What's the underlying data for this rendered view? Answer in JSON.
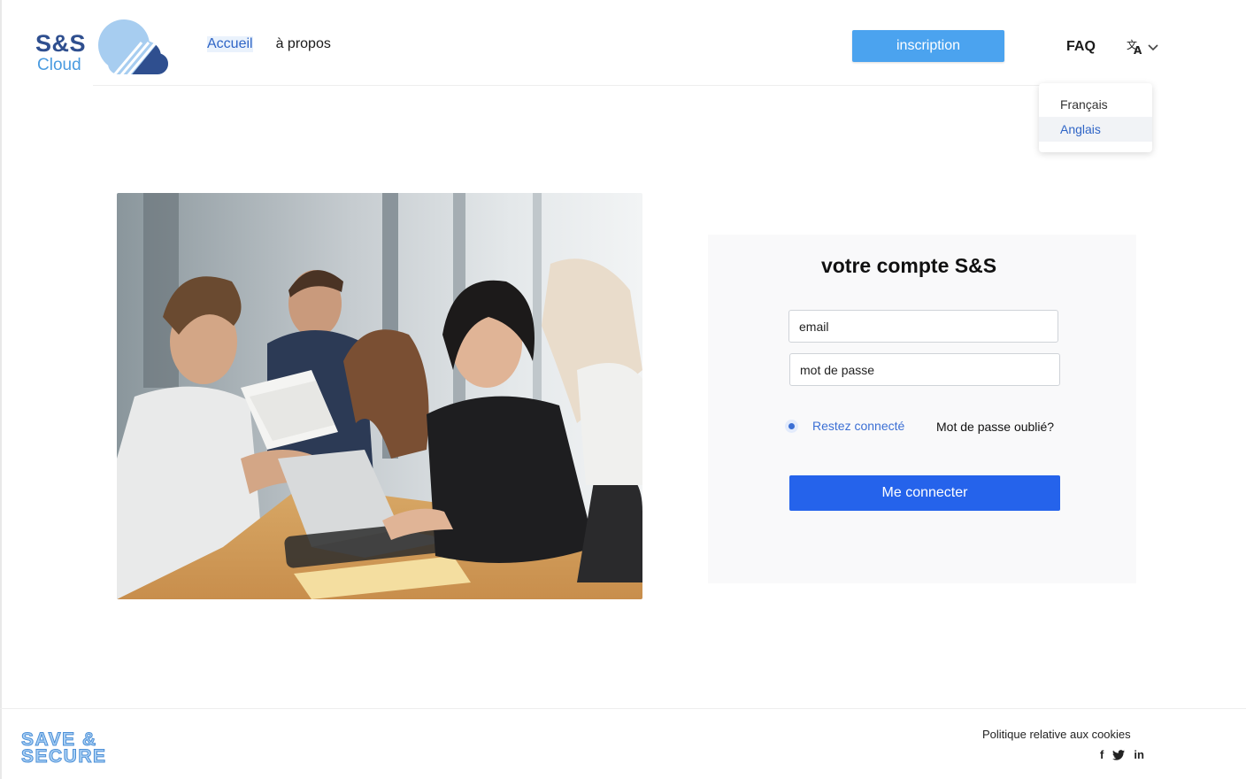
{
  "logo": {
    "line1": "S&S",
    "line2": "Cloud"
  },
  "nav": {
    "home": "Accueil",
    "about": "à propos"
  },
  "header": {
    "signup_label": "inscription",
    "faq_label": "FAQ"
  },
  "language_menu": {
    "options": [
      "Français",
      "Anglais"
    ],
    "selected": "Anglais"
  },
  "login": {
    "title": "votre compte S&S",
    "email_placeholder": "email",
    "password_placeholder": "mot de passe",
    "remember_label": "Restez connecté",
    "forgot_label": "Mot de passe oublié?",
    "submit_label": "Me connecter"
  },
  "footer": {
    "logo_line1": "SAVE &",
    "logo_line2": "SECURE",
    "cookies_label": "Politique relative aux cookies",
    "social": [
      "f",
      "t",
      "in"
    ]
  },
  "colors": {
    "primary": "#2563eb",
    "signup": "#4ba3ef",
    "brand_dark": "#2f4f8f",
    "brand_light": "#4a9be0"
  },
  "icons": [
    "cloud-logo-icon",
    "translate-icon",
    "chevron-down-icon",
    "facebook-icon",
    "twitter-icon",
    "linkedin-icon"
  ]
}
